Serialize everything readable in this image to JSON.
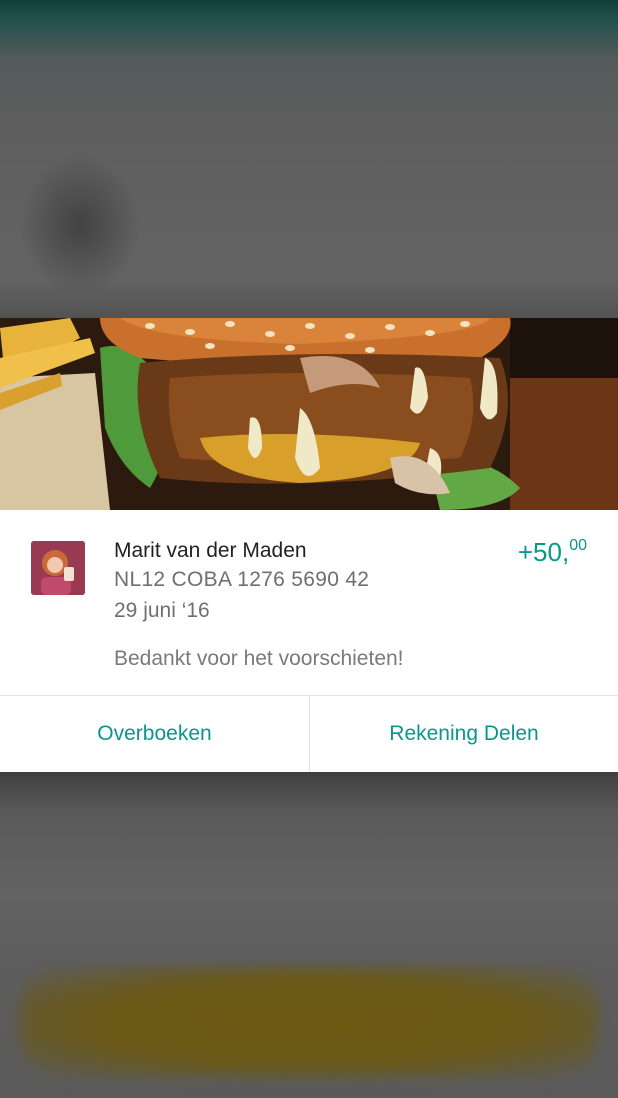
{
  "transaction": {
    "name": "Marit van der Maden",
    "iban": "NL12 COBA 1276 5690 42",
    "date": "29 juni ‘16",
    "message": "Bedankt voor het voorschieten!",
    "amount_main": "+50,",
    "amount_cents": "00"
  },
  "actions": {
    "transfer_label": "Overboeken",
    "share_label": "Rekening Delen"
  },
  "colors": {
    "accent": "#0a968c"
  }
}
